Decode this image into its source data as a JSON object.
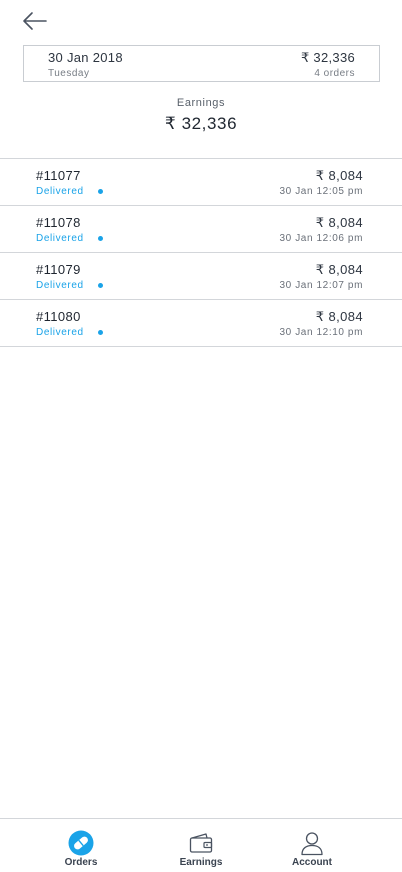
{
  "summary": {
    "date": "30 Jan 2018",
    "day": "Tuesday",
    "amount": "₹ 32,336",
    "orders_count": "4 orders"
  },
  "earnings": {
    "label": "Earnings",
    "value": "₹ 32,336"
  },
  "orders": [
    {
      "id": "#11077",
      "status": "Delivered",
      "amount": "₹ 8,084",
      "time": "30 Jan 12:05 pm"
    },
    {
      "id": "#11078",
      "status": "Delivered",
      "amount": "₹ 8,084",
      "time": "30 Jan 12:06 pm"
    },
    {
      "id": "#11079",
      "status": "Delivered",
      "amount": "₹ 8,084",
      "time": "30 Jan 12:07 pm"
    },
    {
      "id": "#11080",
      "status": "Delivered",
      "amount": "₹ 8,084",
      "time": "30 Jan 12:10 pm"
    }
  ],
  "nav": {
    "orders": "Orders",
    "earnings": "Earnings",
    "account": "Account"
  },
  "colors": {
    "accent": "#1aa3e8",
    "text": "#1f2630",
    "divider": "#d3d6da"
  },
  "icons": {
    "back": "arrow-left-icon",
    "orders": "pill-icon",
    "earnings": "wallet-icon",
    "account": "user-icon"
  }
}
